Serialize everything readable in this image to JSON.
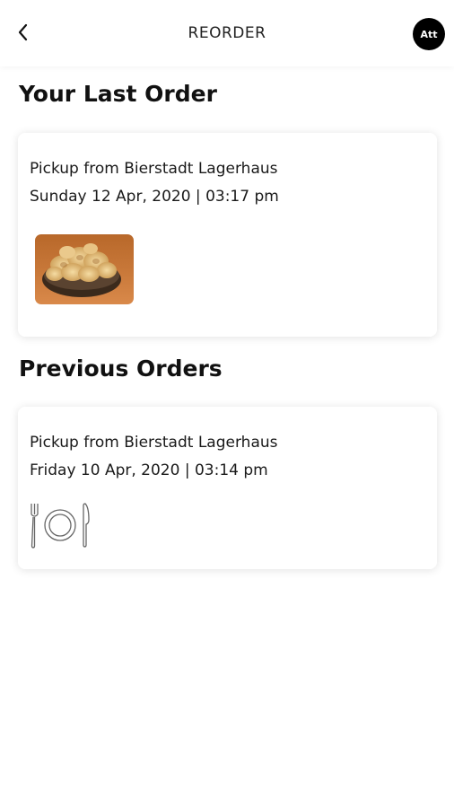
{
  "header": {
    "title": "REORDER",
    "avatar_text": "Att"
  },
  "last_order": {
    "section_title": "Your Last Order",
    "pickup": "Pickup from Bierstadt Lagerhaus",
    "datetime": "Sunday 12 Apr, 2020 | 03:17 pm",
    "image": "pretzel-chips-bowl-photo"
  },
  "previous_orders": {
    "section_title": "Previous Orders",
    "items": [
      {
        "pickup": "Pickup from Bierstadt Lagerhaus",
        "datetime": "Friday 10 Apr, 2020 | 03:14 pm",
        "icon": "plate-cutlery-icon"
      }
    ]
  }
}
